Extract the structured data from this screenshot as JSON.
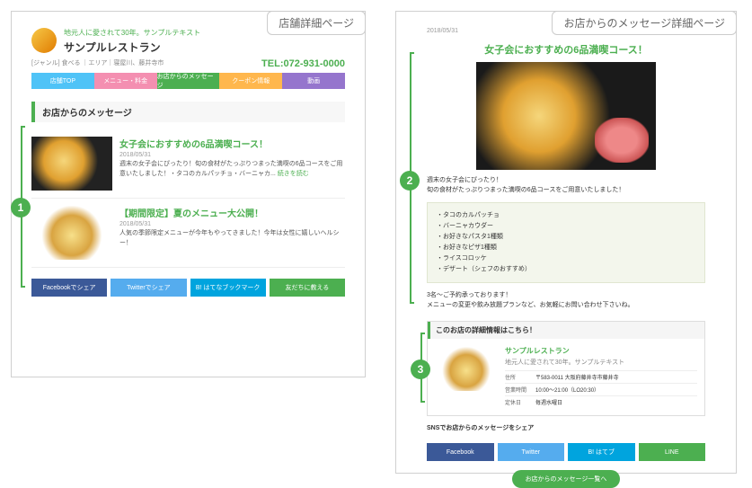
{
  "left": {
    "panel_label": "店舗詳細ページ",
    "tagline": "地元人に愛されて30年。サンプルテキスト",
    "shop_name": "サンプルレストラン",
    "genre": "[ジャンル] 食べる ｜エリア｜寝屋川、藤井寺市",
    "tel": "TEL:072-931-0000",
    "tabs": [
      "店舗TOP",
      "メニュー・料金",
      "お店からのメッセージ",
      "クーポン情報",
      "動画"
    ],
    "section": "お店からのメッセージ",
    "cards": [
      {
        "title": "女子会におすすめの6品満喫コース！",
        "date": "2018/05/31",
        "text": "週末の女子会にぴったり！旬の食材がたっぷりつまった満喫の6品コースをご用意いたしました！・タコのカルパッチョ・バーニャカ... ",
        "more": "続きを読む"
      },
      {
        "title": "【期間限定】夏のメニュー大公開！",
        "date": "2018/05/31",
        "text": "人気の季節限定メニューが今年もやってきました！今年は女性に嬉しいヘルシー！",
        "more": ""
      }
    ],
    "shares": [
      "Facebookでシェア",
      "Twitterでシェア",
      "B! はてなブックマーク",
      "友だちに教える"
    ]
  },
  "right": {
    "panel_label": "お店からのメッセージ詳細ページ",
    "date": "2018/05/31",
    "shop": "サンプルレストラン",
    "title": "女子会におすすめの6品満喫コース！",
    "body1": "週末の女子会にぴったり！",
    "body2": "旬の食材がたっぷりつまった満喫の6品コースをご用意いたしました！",
    "menu": [
      "・タコのカルパッチョ",
      "・バーニャカウダー",
      "・お好きなパスタ1種類",
      "・お好きなピザ1種類",
      "・ライスコロッケ",
      "・デザート（シェフのおすすめ）"
    ],
    "body3a": "3名〜ご予約承っております！",
    "body3b": "メニューの変更や飲み放題プランなど、お気軽にお問い合わせ下さいね。",
    "info_h": "このお店の詳細情報はこちら！",
    "info_name": "サンプルレストラン",
    "info_sub": "地元人に愛されて30年。サンプルテキスト",
    "info_rows": [
      {
        "k": "住所",
        "v": "〒583-0011 大阪府藤井寺市藤井寺"
      },
      {
        "k": "営業時間",
        "v": "10:00〜21:00（LO20:30）"
      },
      {
        "k": "定休日",
        "v": "毎週水曜日"
      }
    ],
    "sns_label": "SNSでお店からのメッセージをシェア",
    "shares": [
      "Facebook",
      "Twitter",
      "B! はてブ",
      "LINE"
    ],
    "back": "お店からのメッセージ一覧へ"
  },
  "badges": [
    "1",
    "2",
    "3"
  ]
}
